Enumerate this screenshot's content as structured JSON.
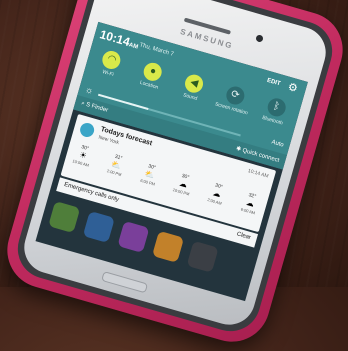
{
  "phone": {
    "brand": "SAMSUNG"
  },
  "status": {
    "time": "10:14",
    "time_suffix": "AM",
    "date": "Thu, March 7",
    "edit_label": "EDIT"
  },
  "toggles": [
    {
      "label": "Wi-Fi",
      "icon": "wifi-icon",
      "glyph": "◠",
      "on": true
    },
    {
      "label": "Location",
      "icon": "location-icon",
      "glyph": "●",
      "on": true
    },
    {
      "label": "Sound",
      "icon": "sound-icon",
      "glyph": "◀",
      "on": true
    },
    {
      "label": "Screen rotation",
      "icon": "rotation-icon",
      "glyph": "⟳",
      "on": false
    },
    {
      "label": "Bluetooth",
      "icon": "bluetooth-icon",
      "glyph": "ᛒ",
      "on": false
    }
  ],
  "brightness": {
    "level": 0.35,
    "auto_label": "Auto"
  },
  "quick_bar": {
    "s_finder": "S Finder",
    "quick_connect": "Quick connect"
  },
  "weather": {
    "title": "Todays forecast",
    "city": "New York",
    "time": "10:14 AM",
    "hours": [
      {
        "temp": "30°",
        "icon": "☀",
        "hour": "10:00 AM"
      },
      {
        "temp": "31°",
        "icon": "⛅",
        "hour": "2:00 PM"
      },
      {
        "temp": "30°",
        "icon": "⛅",
        "hour": "6:00 PM"
      },
      {
        "temp": "30°",
        "icon": "☁",
        "hour": "10:00 PM"
      },
      {
        "temp": "30°",
        "icon": "☁",
        "hour": "2:00 AM"
      },
      {
        "temp": "32°",
        "icon": "☁",
        "hour": "6:00 AM"
      }
    ]
  },
  "notifications": {
    "emergency": "Emergency calls only",
    "clear": "Clear"
  },
  "colors": {
    "case": "#c02a5e",
    "panel": "#3b8a8e"
  }
}
